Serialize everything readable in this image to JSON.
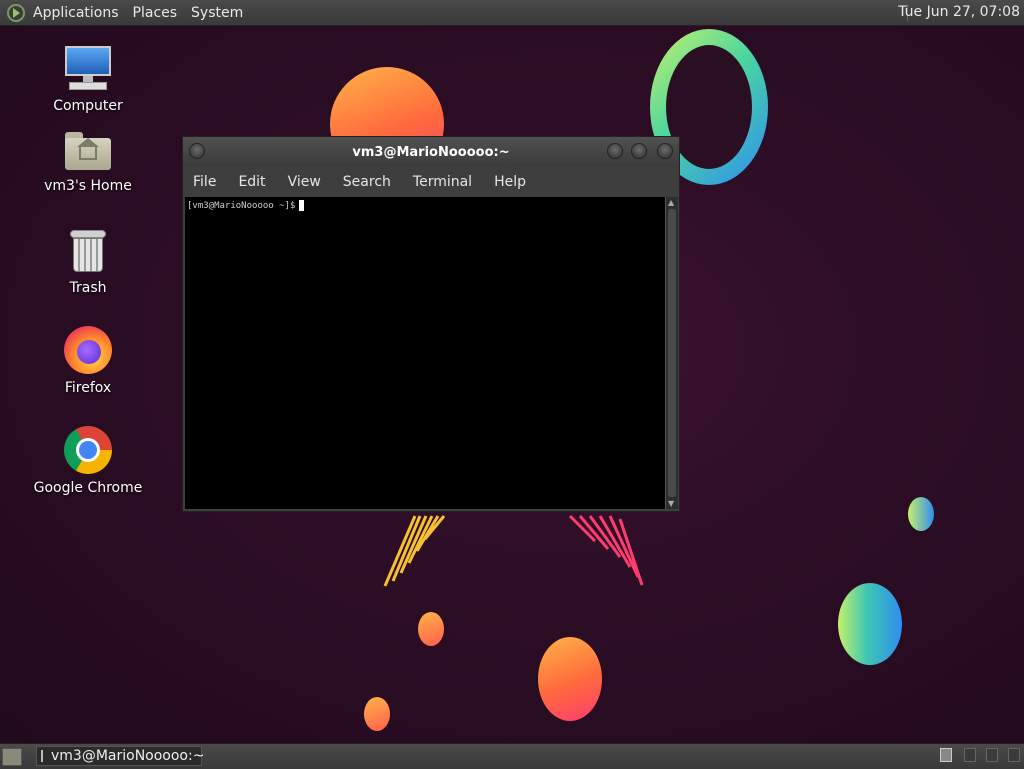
{
  "top_panel": {
    "menus": [
      "Applications",
      "Places",
      "System"
    ],
    "clock": "Tue Jun 27, 07:08"
  },
  "desktop_icons": [
    {
      "label": "Computer",
      "icon": "computer-icon"
    },
    {
      "label": "vm3's Home",
      "icon": "home-folder-icon"
    },
    {
      "label": "Trash",
      "icon": "trash-icon"
    },
    {
      "label": "Firefox",
      "icon": "firefox-icon"
    },
    {
      "label": "Google Chrome",
      "icon": "chrome-icon"
    }
  ],
  "terminal": {
    "title": "vm3@MarioNooooo:~",
    "menu": [
      "File",
      "Edit",
      "View",
      "Search",
      "Terminal",
      "Help"
    ],
    "prompt": "[vm3@MarioNooooo ~]$"
  },
  "taskbar": {
    "window_label": "vm3@MarioNooooo:~"
  },
  "colors": {
    "panel": "#3f3f3f",
    "wallpaper": "#2c0d25",
    "terminal_bg": "#000000"
  }
}
